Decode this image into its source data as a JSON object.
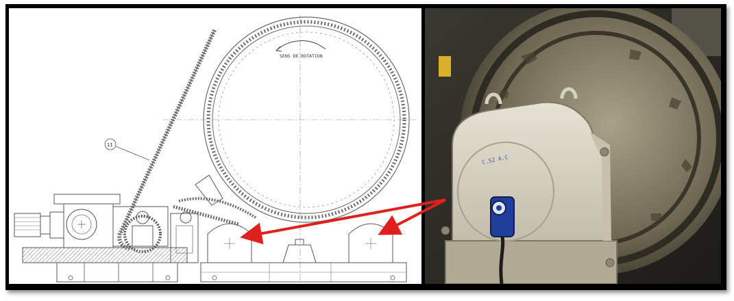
{
  "drawing": {
    "rotation_label": "SENS DE ROTATION",
    "part_number": "11",
    "stamp": "C.52 A.C"
  },
  "colors": {
    "frame": "#000000",
    "arrow": "#e0201c",
    "line": "#555555",
    "sensor": "#1f3f9a",
    "housing": "#d8d2c3"
  }
}
